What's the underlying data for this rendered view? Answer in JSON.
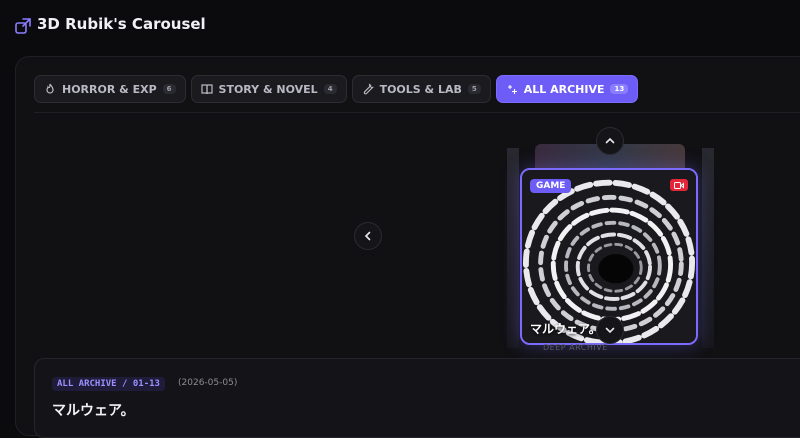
{
  "app": {
    "title": "3D Rubik's Carousel",
    "accent": "#6d5cf6"
  },
  "tabs": [
    {
      "label": "HORROR & EXP",
      "count": "6",
      "icon": "flame-icon",
      "active": false
    },
    {
      "label": "STORY & NOVEL",
      "count": "4",
      "icon": "book-icon",
      "active": false
    },
    {
      "label": "TOOLS & LAB",
      "count": "5",
      "icon": "wrench-icon",
      "active": false
    },
    {
      "label": "ALL ARCHIVE",
      "count": "13",
      "icon": "sparkles-icon",
      "active": true
    }
  ],
  "carousel": {
    "card": {
      "category": "GAME",
      "title": "マルウェア。",
      "video_badge_color": "#e3263a"
    },
    "ghost_label": "DEEP ARCHIVE"
  },
  "detail": {
    "breadcrumb": "ALL ARCHIVE / 01-13",
    "date": "(2026-05-05)",
    "title": "マルウェア。"
  }
}
